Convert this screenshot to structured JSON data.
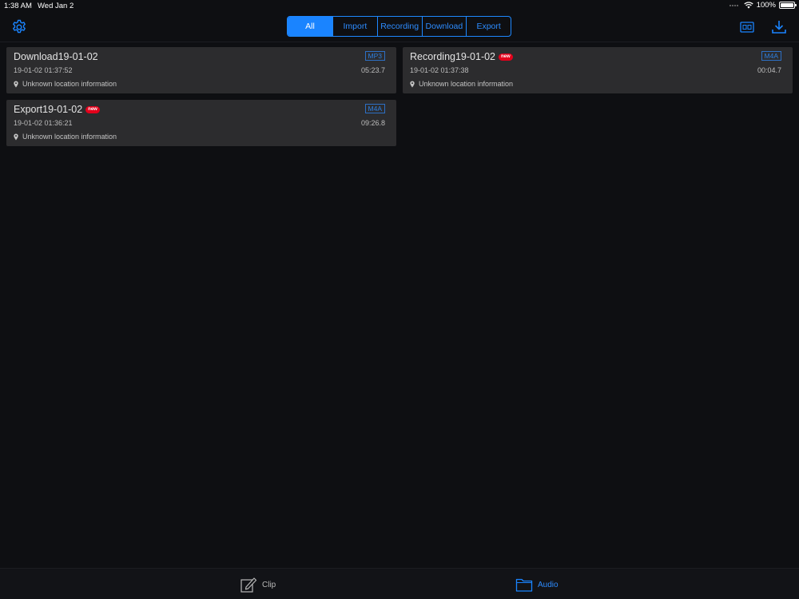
{
  "status": {
    "time": "1:38 AM",
    "date": "Wed Jan 2",
    "battery": "100%"
  },
  "filters": {
    "tabs": [
      {
        "label": "All",
        "active": true
      },
      {
        "label": "Import",
        "active": false
      },
      {
        "label": "Recording",
        "active": false
      },
      {
        "label": "Download",
        "active": false
      },
      {
        "label": "Export",
        "active": false
      }
    ]
  },
  "header": {
    "left_icon": "gear-icon",
    "right_icons": [
      "caption-icon",
      "download-icon"
    ]
  },
  "items": [
    {
      "title": "Download19-01-02",
      "is_new": false,
      "format": "MP3",
      "datetime": "19-01-02 01:37:52",
      "duration": "05:23.7",
      "location": "Unknown location information"
    },
    {
      "title": "Recording19-01-02",
      "is_new": true,
      "format": "M4A",
      "datetime": "19-01-02 01:37:38",
      "duration": "00:04.7",
      "location": "Unknown location information"
    },
    {
      "title": "Export19-01-02",
      "is_new": true,
      "format": "M4A",
      "datetime": "19-01-02 01:36:21",
      "duration": "09:26.8",
      "location": "Unknown location information"
    }
  ],
  "new_badge": "new",
  "tabbar": {
    "clip_label": "Clip",
    "audio_label": "Audio",
    "active": "Audio"
  },
  "colors": {
    "accent": "#1a84ff",
    "background": "#0e0f12",
    "card": "#2c2c2e",
    "new_badge": "#e3001b"
  }
}
